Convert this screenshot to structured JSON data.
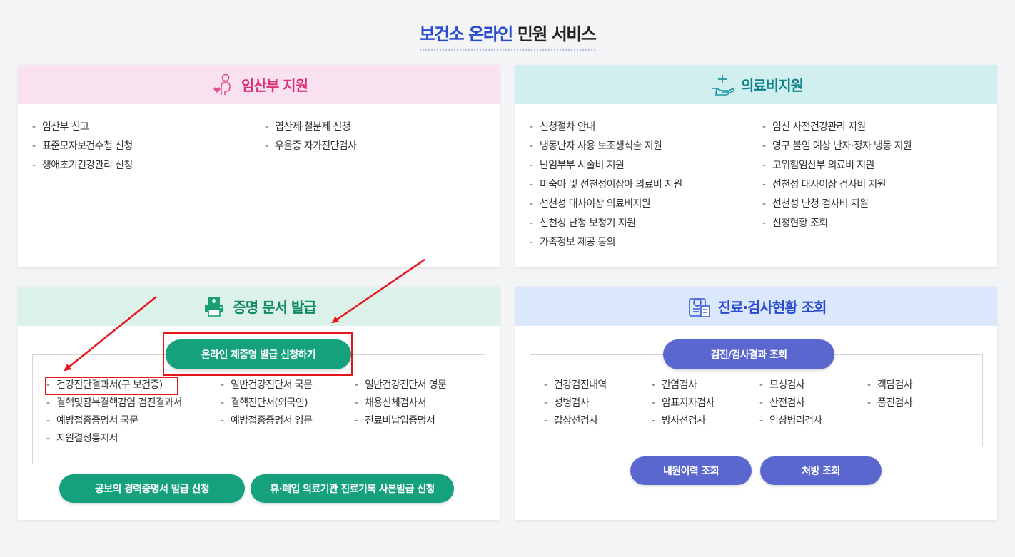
{
  "title": {
    "highlight": "보건소 온라인",
    "rest": " 민원 서비스"
  },
  "pregnant": {
    "heading": "임산부 지원",
    "col1": [
      "임산부 신고",
      "표준모자보건수첩 신청",
      "생애초기건강관리 신청"
    ],
    "col2": [
      "엽산제·철분제 신청",
      "우울증 자가진단검사"
    ]
  },
  "medical": {
    "heading": "의료비지원",
    "col1": [
      "신청절차 안내",
      "냉동난자 사용 보조생식술 지원",
      "난임부부 시술비 지원",
      "미숙아 및 선천성이상아 의료비 지원",
      "선천성 대사이상 의료비지원",
      "선천성 난청 보청기 지원",
      "가족정보 제공 동의"
    ],
    "col2": [
      "임신 사전건강관리 지원",
      "영구 불임 예상 난자·정자 냉동 지원",
      "고위험임산부 의료비 지원",
      "선천성 대사이상 검사비 지원",
      "선천성 난청 검사비 지원",
      "신청현황 조회"
    ]
  },
  "cert": {
    "heading": "증명 문서 발급",
    "online_button": "온라인 제증명 발급 신청하기",
    "col1": [
      "건강진단결과서(구 보건증)",
      "결핵및잠복결핵감염 검진결과서",
      "예방접종증명서 국문",
      "지원결정통지서"
    ],
    "col2": [
      "일반건강진단서 국문",
      "결핵진단서(외국인)",
      "예방접종증명서 영문"
    ],
    "col3": [
      "일반건강진단서 영문",
      "채용신체검사서",
      "진료비납입증명서"
    ],
    "career_button": "공보의 경력증명서 발급 신청",
    "records_button": "휴·폐업 의료기관 진료기록 사본발급 신청"
  },
  "exam": {
    "heading": "진료·검사현황 조회",
    "results_button": "검진/검사결과 조회",
    "col1": [
      "건강검진내역",
      "성병검사",
      "갑상선검사"
    ],
    "col2": [
      "간염검사",
      "암표지자검사",
      "방사선검사"
    ],
    "col3": [
      "모성검사",
      "산전검사",
      "임상병리검사"
    ],
    "col4": [
      "객담검사",
      "풍진검사"
    ],
    "history_button": "내원이력 조회",
    "prescription_button": "처방 조회"
  },
  "colors": {
    "pregnant": "#d9307b",
    "medical": "#0f8189",
    "cert": "#0e8a62",
    "exam": "#2a4bd0",
    "annotation": "#e8141c"
  }
}
